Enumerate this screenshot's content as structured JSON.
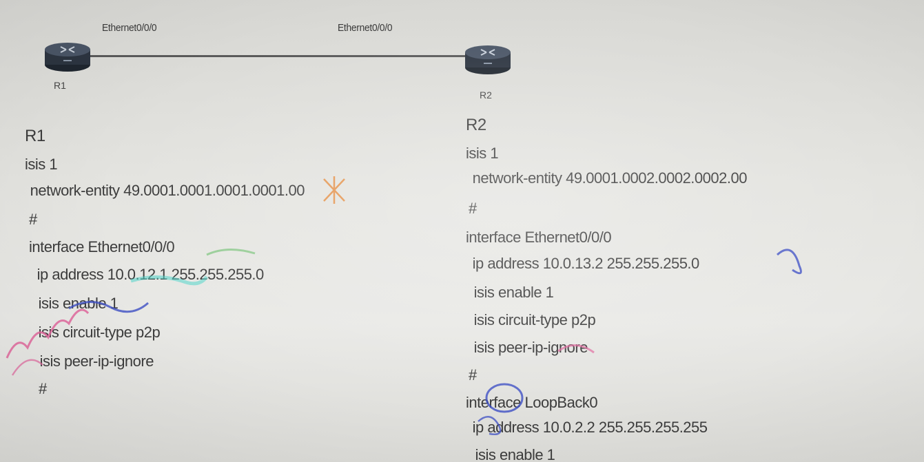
{
  "topology": {
    "r1_label": "R1",
    "r2_label": "R2",
    "r1_interface": "Ethernet0/0/0",
    "r2_interface": "Ethernet0/0/0"
  },
  "r1_config": {
    "lines": [
      "R1",
      "isis 1",
      " network-entity 49.0001.0001.0001.0001.00",
      "#",
      "interface Ethernet0/0/0",
      " ip address 10.0.12.1 255.255.255.0",
      " isis enable 1",
      " isis circuit-type p2p",
      " isis peer-ip-ignore",
      "#"
    ]
  },
  "r2_config": {
    "lines": [
      "R2",
      "isis 1",
      " network-entity 49.0001.0002.0002.0002.00",
      "#",
      "interface Ethernet0/0/0",
      " ip address 10.0.13.2 255.255.255.0",
      " isis enable 1",
      " isis circuit-type p2p",
      " isis peer-ip-ignore",
      "#",
      "interface LoopBack0",
      " ip address 10.0.2.2 255.255.255.255",
      " isis enable 1"
    ]
  },
  "colors": {
    "router_body": "#2c3440",
    "router_top": "#4a5566",
    "text": "#3c3c3c",
    "annotation_pink": "#e0679c",
    "annotation_blue": "#3d4fc4",
    "annotation_cyan": "#4fd4c8",
    "annotation_orange": "#e58a3a",
    "annotation_green": "#58b85a"
  },
  "icons": {
    "router": "router-icon"
  }
}
